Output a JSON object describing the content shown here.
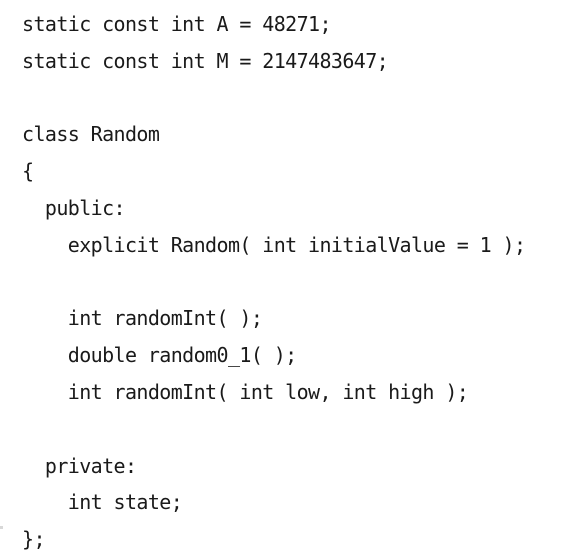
{
  "code": {
    "lines": [
      "static const int A = 48271;",
      "static const int M = 2147483647;",
      "",
      "class Random",
      "{",
      "  public:",
      "    explicit Random( int initialValue = 1 );",
      "",
      "    int randomInt( );",
      "    double random0_1( );",
      "    int randomInt( int low, int high );",
      "",
      "  private:",
      "    int state;",
      "};"
    ]
  }
}
